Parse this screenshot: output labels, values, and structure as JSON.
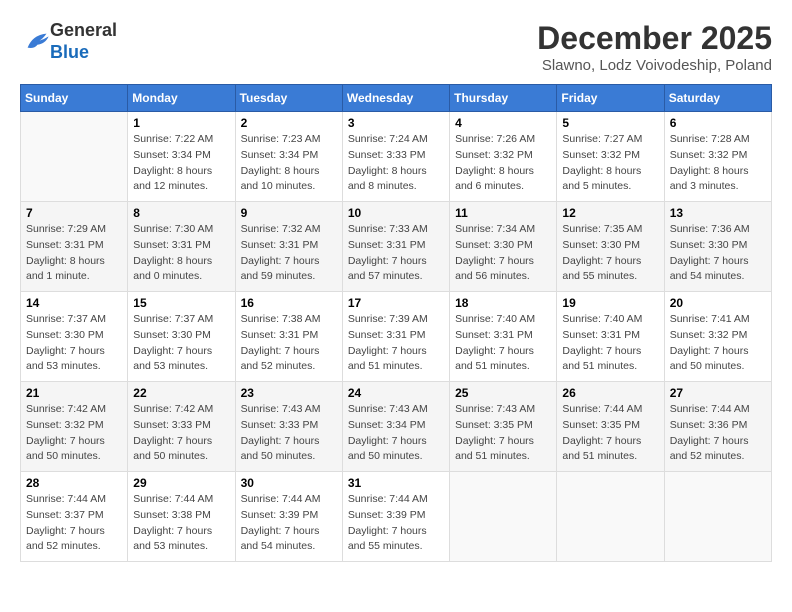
{
  "logo": {
    "general": "General",
    "blue": "Blue"
  },
  "header": {
    "month": "December 2025",
    "location": "Slawno, Lodz Voivodeship, Poland"
  },
  "weekdays": [
    "Sunday",
    "Monday",
    "Tuesday",
    "Wednesday",
    "Thursday",
    "Friday",
    "Saturday"
  ],
  "weeks": [
    [
      {
        "day": "",
        "sunrise": "",
        "sunset": "",
        "daylight": ""
      },
      {
        "day": "1",
        "sunrise": "Sunrise: 7:22 AM",
        "sunset": "Sunset: 3:34 PM",
        "daylight": "Daylight: 8 hours and 12 minutes."
      },
      {
        "day": "2",
        "sunrise": "Sunrise: 7:23 AM",
        "sunset": "Sunset: 3:34 PM",
        "daylight": "Daylight: 8 hours and 10 minutes."
      },
      {
        "day": "3",
        "sunrise": "Sunrise: 7:24 AM",
        "sunset": "Sunset: 3:33 PM",
        "daylight": "Daylight: 8 hours and 8 minutes."
      },
      {
        "day": "4",
        "sunrise": "Sunrise: 7:26 AM",
        "sunset": "Sunset: 3:32 PM",
        "daylight": "Daylight: 8 hours and 6 minutes."
      },
      {
        "day": "5",
        "sunrise": "Sunrise: 7:27 AM",
        "sunset": "Sunset: 3:32 PM",
        "daylight": "Daylight: 8 hours and 5 minutes."
      },
      {
        "day": "6",
        "sunrise": "Sunrise: 7:28 AM",
        "sunset": "Sunset: 3:32 PM",
        "daylight": "Daylight: 8 hours and 3 minutes."
      }
    ],
    [
      {
        "day": "7",
        "sunrise": "Sunrise: 7:29 AM",
        "sunset": "Sunset: 3:31 PM",
        "daylight": "Daylight: 8 hours and 1 minute."
      },
      {
        "day": "8",
        "sunrise": "Sunrise: 7:30 AM",
        "sunset": "Sunset: 3:31 PM",
        "daylight": "Daylight: 8 hours and 0 minutes."
      },
      {
        "day": "9",
        "sunrise": "Sunrise: 7:32 AM",
        "sunset": "Sunset: 3:31 PM",
        "daylight": "Daylight: 7 hours and 59 minutes."
      },
      {
        "day": "10",
        "sunrise": "Sunrise: 7:33 AM",
        "sunset": "Sunset: 3:31 PM",
        "daylight": "Daylight: 7 hours and 57 minutes."
      },
      {
        "day": "11",
        "sunrise": "Sunrise: 7:34 AM",
        "sunset": "Sunset: 3:30 PM",
        "daylight": "Daylight: 7 hours and 56 minutes."
      },
      {
        "day": "12",
        "sunrise": "Sunrise: 7:35 AM",
        "sunset": "Sunset: 3:30 PM",
        "daylight": "Daylight: 7 hours and 55 minutes."
      },
      {
        "day": "13",
        "sunrise": "Sunrise: 7:36 AM",
        "sunset": "Sunset: 3:30 PM",
        "daylight": "Daylight: 7 hours and 54 minutes."
      }
    ],
    [
      {
        "day": "14",
        "sunrise": "Sunrise: 7:37 AM",
        "sunset": "Sunset: 3:30 PM",
        "daylight": "Daylight: 7 hours and 53 minutes."
      },
      {
        "day": "15",
        "sunrise": "Sunrise: 7:37 AM",
        "sunset": "Sunset: 3:30 PM",
        "daylight": "Daylight: 7 hours and 53 minutes."
      },
      {
        "day": "16",
        "sunrise": "Sunrise: 7:38 AM",
        "sunset": "Sunset: 3:31 PM",
        "daylight": "Daylight: 7 hours and 52 minutes."
      },
      {
        "day": "17",
        "sunrise": "Sunrise: 7:39 AM",
        "sunset": "Sunset: 3:31 PM",
        "daylight": "Daylight: 7 hours and 51 minutes."
      },
      {
        "day": "18",
        "sunrise": "Sunrise: 7:40 AM",
        "sunset": "Sunset: 3:31 PM",
        "daylight": "Daylight: 7 hours and 51 minutes."
      },
      {
        "day": "19",
        "sunrise": "Sunrise: 7:40 AM",
        "sunset": "Sunset: 3:31 PM",
        "daylight": "Daylight: 7 hours and 51 minutes."
      },
      {
        "day": "20",
        "sunrise": "Sunrise: 7:41 AM",
        "sunset": "Sunset: 3:32 PM",
        "daylight": "Daylight: 7 hours and 50 minutes."
      }
    ],
    [
      {
        "day": "21",
        "sunrise": "Sunrise: 7:42 AM",
        "sunset": "Sunset: 3:32 PM",
        "daylight": "Daylight: 7 hours and 50 minutes."
      },
      {
        "day": "22",
        "sunrise": "Sunrise: 7:42 AM",
        "sunset": "Sunset: 3:33 PM",
        "daylight": "Daylight: 7 hours and 50 minutes."
      },
      {
        "day": "23",
        "sunrise": "Sunrise: 7:43 AM",
        "sunset": "Sunset: 3:33 PM",
        "daylight": "Daylight: 7 hours and 50 minutes."
      },
      {
        "day": "24",
        "sunrise": "Sunrise: 7:43 AM",
        "sunset": "Sunset: 3:34 PM",
        "daylight": "Daylight: 7 hours and 50 minutes."
      },
      {
        "day": "25",
        "sunrise": "Sunrise: 7:43 AM",
        "sunset": "Sunset: 3:35 PM",
        "daylight": "Daylight: 7 hours and 51 minutes."
      },
      {
        "day": "26",
        "sunrise": "Sunrise: 7:44 AM",
        "sunset": "Sunset: 3:35 PM",
        "daylight": "Daylight: 7 hours and 51 minutes."
      },
      {
        "day": "27",
        "sunrise": "Sunrise: 7:44 AM",
        "sunset": "Sunset: 3:36 PM",
        "daylight": "Daylight: 7 hours and 52 minutes."
      }
    ],
    [
      {
        "day": "28",
        "sunrise": "Sunrise: 7:44 AM",
        "sunset": "Sunset: 3:37 PM",
        "daylight": "Daylight: 7 hours and 52 minutes."
      },
      {
        "day": "29",
        "sunrise": "Sunrise: 7:44 AM",
        "sunset": "Sunset: 3:38 PM",
        "daylight": "Daylight: 7 hours and 53 minutes."
      },
      {
        "day": "30",
        "sunrise": "Sunrise: 7:44 AM",
        "sunset": "Sunset: 3:39 PM",
        "daylight": "Daylight: 7 hours and 54 minutes."
      },
      {
        "day": "31",
        "sunrise": "Sunrise: 7:44 AM",
        "sunset": "Sunset: 3:39 PM",
        "daylight": "Daylight: 7 hours and 55 minutes."
      },
      {
        "day": "",
        "sunrise": "",
        "sunset": "",
        "daylight": ""
      },
      {
        "day": "",
        "sunrise": "",
        "sunset": "",
        "daylight": ""
      },
      {
        "day": "",
        "sunrise": "",
        "sunset": "",
        "daylight": ""
      }
    ]
  ]
}
